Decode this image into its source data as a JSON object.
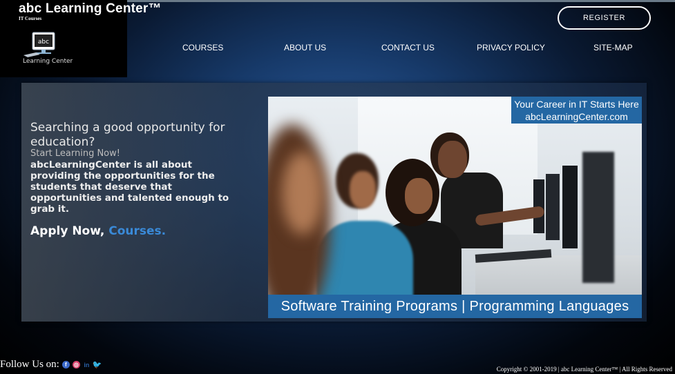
{
  "brand": {
    "title": "abc Learning Center™",
    "subtitle": "IT Courses",
    "logo_text": "abc",
    "logo_label": "Learning Center"
  },
  "header": {
    "register_label": "REGISTER"
  },
  "nav": {
    "items": [
      {
        "label": "COURSES"
      },
      {
        "label": "ABOUT US"
      },
      {
        "label": "CONTACT US"
      },
      {
        "label": "PRIVACY POLICY"
      },
      {
        "label": "SITE-MAP"
      }
    ]
  },
  "hero": {
    "headline": "Searching a good opportunity for education?",
    "sub_line": "Start Learning Now!",
    "description": "abcLearningCenter is all about providing the opportunities for the students that deserve that opportunities and talented enough to grab it.",
    "apply_text": "Apply Now,",
    "courses_link": "Courses.",
    "courses_link_color": "#3a8ad8"
  },
  "banner": {
    "top_line1": "Your Career in IT Starts Here",
    "top_line2": "abcLearningCenter.com",
    "bottom_text": "Software Training Programs | Programming Languages",
    "caption_bg": "#2467a3"
  },
  "footer": {
    "follow_label": "Follow Us on:",
    "social_icons": [
      "facebook-icon",
      "instagram-icon",
      "linkedin-icon",
      "twitter-icon"
    ],
    "copyright": "Copyright © 2001-2019 | abc Learning Center™ | All Rights Reserved"
  }
}
